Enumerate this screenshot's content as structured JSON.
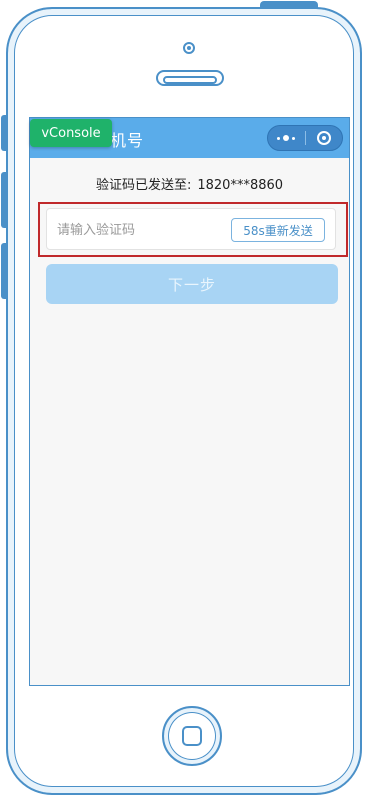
{
  "app": {
    "nav_title": "机号"
  },
  "vconsole": {
    "label": "vConsole"
  },
  "verification": {
    "sent_label": "验证码已发送至:",
    "phone_masked": "1820***8860",
    "code_placeholder": "请输入验证码",
    "code_value": "",
    "resend_label": "58s重新发送"
  },
  "actions": {
    "next_label": "下一步"
  },
  "icons": {
    "menu": "more-dots-icon",
    "close": "close-circle-icon"
  },
  "colors": {
    "accent": "#5aacea",
    "vconsole": "#1fb26a",
    "highlight_border": "#c0292b",
    "next_disabled": "#a8d4f4"
  }
}
